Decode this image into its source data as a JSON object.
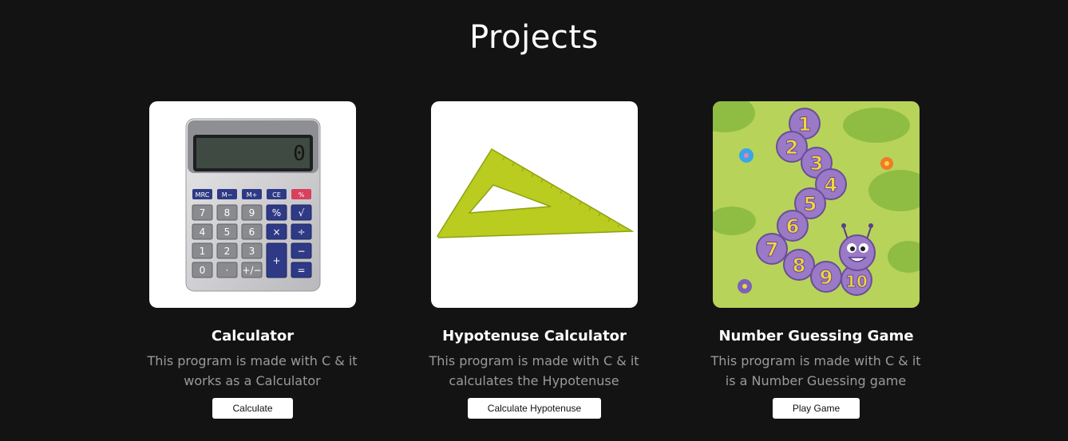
{
  "page": {
    "title": "Projects"
  },
  "projects": [
    {
      "title": "Calculator",
      "description": "This program is made with C & it works as a Calculator",
      "button": "Calculate",
      "image": "calculator-image",
      "display_value": "0",
      "keys": {
        "memory": [
          "MRC",
          "M−",
          "M+",
          "CE",
          "%"
        ],
        "rows": [
          [
            "7",
            "8",
            "9",
            "%",
            "√"
          ],
          [
            "4",
            "5",
            "6",
            "×",
            "÷"
          ],
          [
            "1",
            "2",
            "3",
            "+",
            "−"
          ],
          [
            "0",
            "·",
            "+/−",
            "",
            "="
          ]
        ]
      }
    },
    {
      "title": "Hypotenuse Calculator",
      "description": "This program is made with C & it calculates the Hypotenuse",
      "button": "Calculate Hypotenuse",
      "image": "set-square-image"
    },
    {
      "title": "Number Guessing Game",
      "description": "This program is made with C & it is a Number Guessing game",
      "button": "Play Game",
      "image": "caterpillar-numbers-image",
      "numbers": [
        "1",
        "2",
        "3",
        "4",
        "5",
        "6",
        "7",
        "8",
        "9",
        "10"
      ]
    }
  ],
  "colors": {
    "background": "#141314",
    "desc_text": "#9a9a9a",
    "game_bg": "#b7d35a",
    "bug": "#9a79c6",
    "digits": "#f5d63a"
  }
}
